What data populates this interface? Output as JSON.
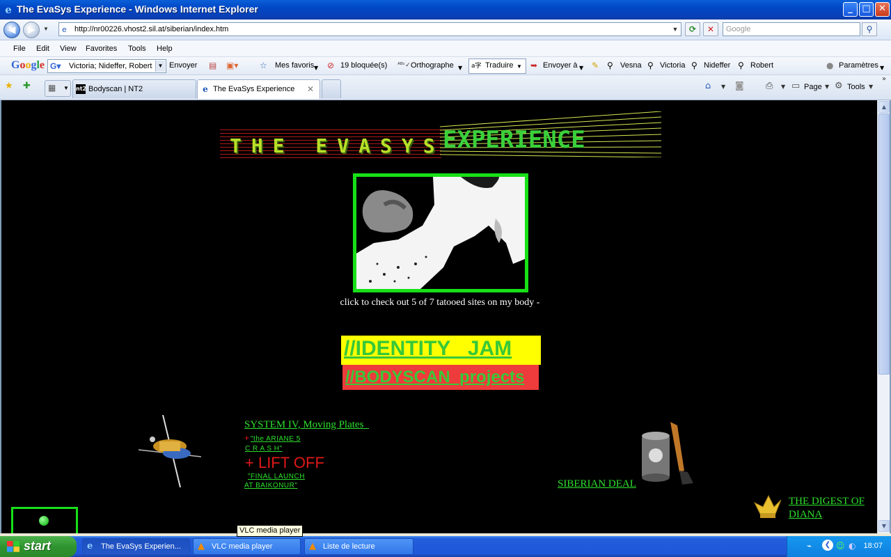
{
  "window": {
    "title": "The EvaSys Experience - Windows Internet Explorer",
    "minimize": "_",
    "maximize": "□",
    "close": "✕"
  },
  "address_bar": {
    "url": "http://nr00226.vhost2.sil.at/siberian/index.htm",
    "search_placeholder": "Google"
  },
  "menu": [
    "File",
    "Edit",
    "View",
    "Favorites",
    "Tools",
    "Help"
  ],
  "google_toolbar": {
    "logo": "Google",
    "search_value": "Victoria; Nideffer, Robert",
    "send": "Envoyer",
    "favorites": "Mes favoris",
    "blocked": "19 bloquée(s)",
    "spelling": "Orthographe",
    "translate": "Traduire",
    "send_to": "Envoyer à",
    "terms": [
      "Vesna",
      "Victoria",
      "Nideffer",
      "Robert"
    ],
    "settings": "Paramètres"
  },
  "tabs": [
    {
      "label": "Bodyscan | NT2",
      "icon": "nt2"
    },
    {
      "label": "The EvaSys Experience",
      "icon": "ie"
    }
  ],
  "command_bar": {
    "page": "Page",
    "tools": "Tools"
  },
  "content": {
    "banner_text": "THE EVASYS",
    "banner_exp": "EXPERIENCE",
    "caption": "click to check out 5 of 7 tatooed sites on my body -",
    "identity_jam": "//IDENTITY _JAM",
    "bodyscan": "//BODYSCAN_projects",
    "system_iv": "SYSTEM IV, Moving Plates",
    "ariane_1": "\"the ARIANE 5",
    "ariane_2": "C R A S H\"",
    "liftoff": "+ LIFT OFF",
    "final_1": "\"FINAL LAUNCH",
    "final_2": "AT BAIKONUR\"",
    "siberian": "SIBERIAN DEAL",
    "digest_1": "THE DIGEST OF",
    "digest_2": "DIANA",
    "plus": "+"
  },
  "tooltip": "VLC media player",
  "taskbar": {
    "start": "start",
    "tasks": [
      "The EvaSys Experien...",
      "VLC media player",
      "Liste de lecture"
    ],
    "clock": "18:07"
  },
  "colors": {
    "link_green": "#2de02d",
    "jam_bg": "#ffff00",
    "bodyscan_bg": "#ee3b3b",
    "liftoff_red": "#e01818"
  }
}
